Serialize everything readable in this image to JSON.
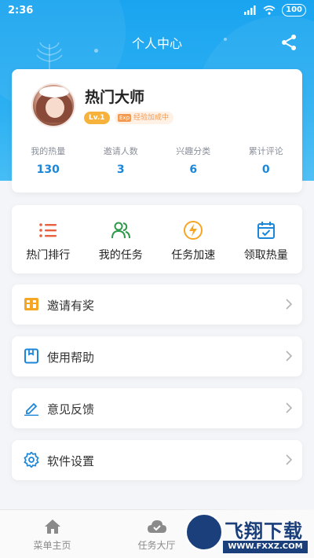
{
  "status_bar": {
    "time": "2:36",
    "battery": "100"
  },
  "header": {
    "title": "个人中心"
  },
  "profile": {
    "username": "热门大师",
    "level": "Lv.1",
    "boost_badge": "经验加成中",
    "stats": [
      {
        "label": "我的热量",
        "value": "130"
      },
      {
        "label": "邀请人数",
        "value": "3"
      },
      {
        "label": "兴趣分类",
        "value": "6"
      },
      {
        "label": "累计评论",
        "value": "0"
      }
    ]
  },
  "quick_actions": [
    {
      "label": "热门排行",
      "icon": "list-icon",
      "color": "#e8603c"
    },
    {
      "label": "我的任务",
      "icon": "users-icon",
      "color": "#2e9a4a"
    },
    {
      "label": "任务加速",
      "icon": "lightning-icon",
      "color": "#f5a623"
    },
    {
      "label": "领取热量",
      "icon": "calendar-check-icon",
      "color": "#1c86d8"
    }
  ],
  "menu": [
    {
      "label": "邀请有奖",
      "icon": "gift-icon"
    },
    {
      "label": "使用帮助",
      "icon": "book-icon"
    },
    {
      "label": "意见反馈",
      "icon": "edit-icon"
    },
    {
      "label": "软件设置",
      "icon": "gear-icon"
    }
  ],
  "tabbar": [
    {
      "label": "菜单主页",
      "icon": "home-icon"
    },
    {
      "label": "任务大厅",
      "icon": "cloud-icon"
    }
  ],
  "watermark": {
    "text": "飞翔下载",
    "url": "WWW.FXXZ.COM"
  },
  "colors": {
    "header_blue": "#1aa4f0",
    "stat_blue": "#1c86d8",
    "level_orange": "#f7b23b"
  }
}
